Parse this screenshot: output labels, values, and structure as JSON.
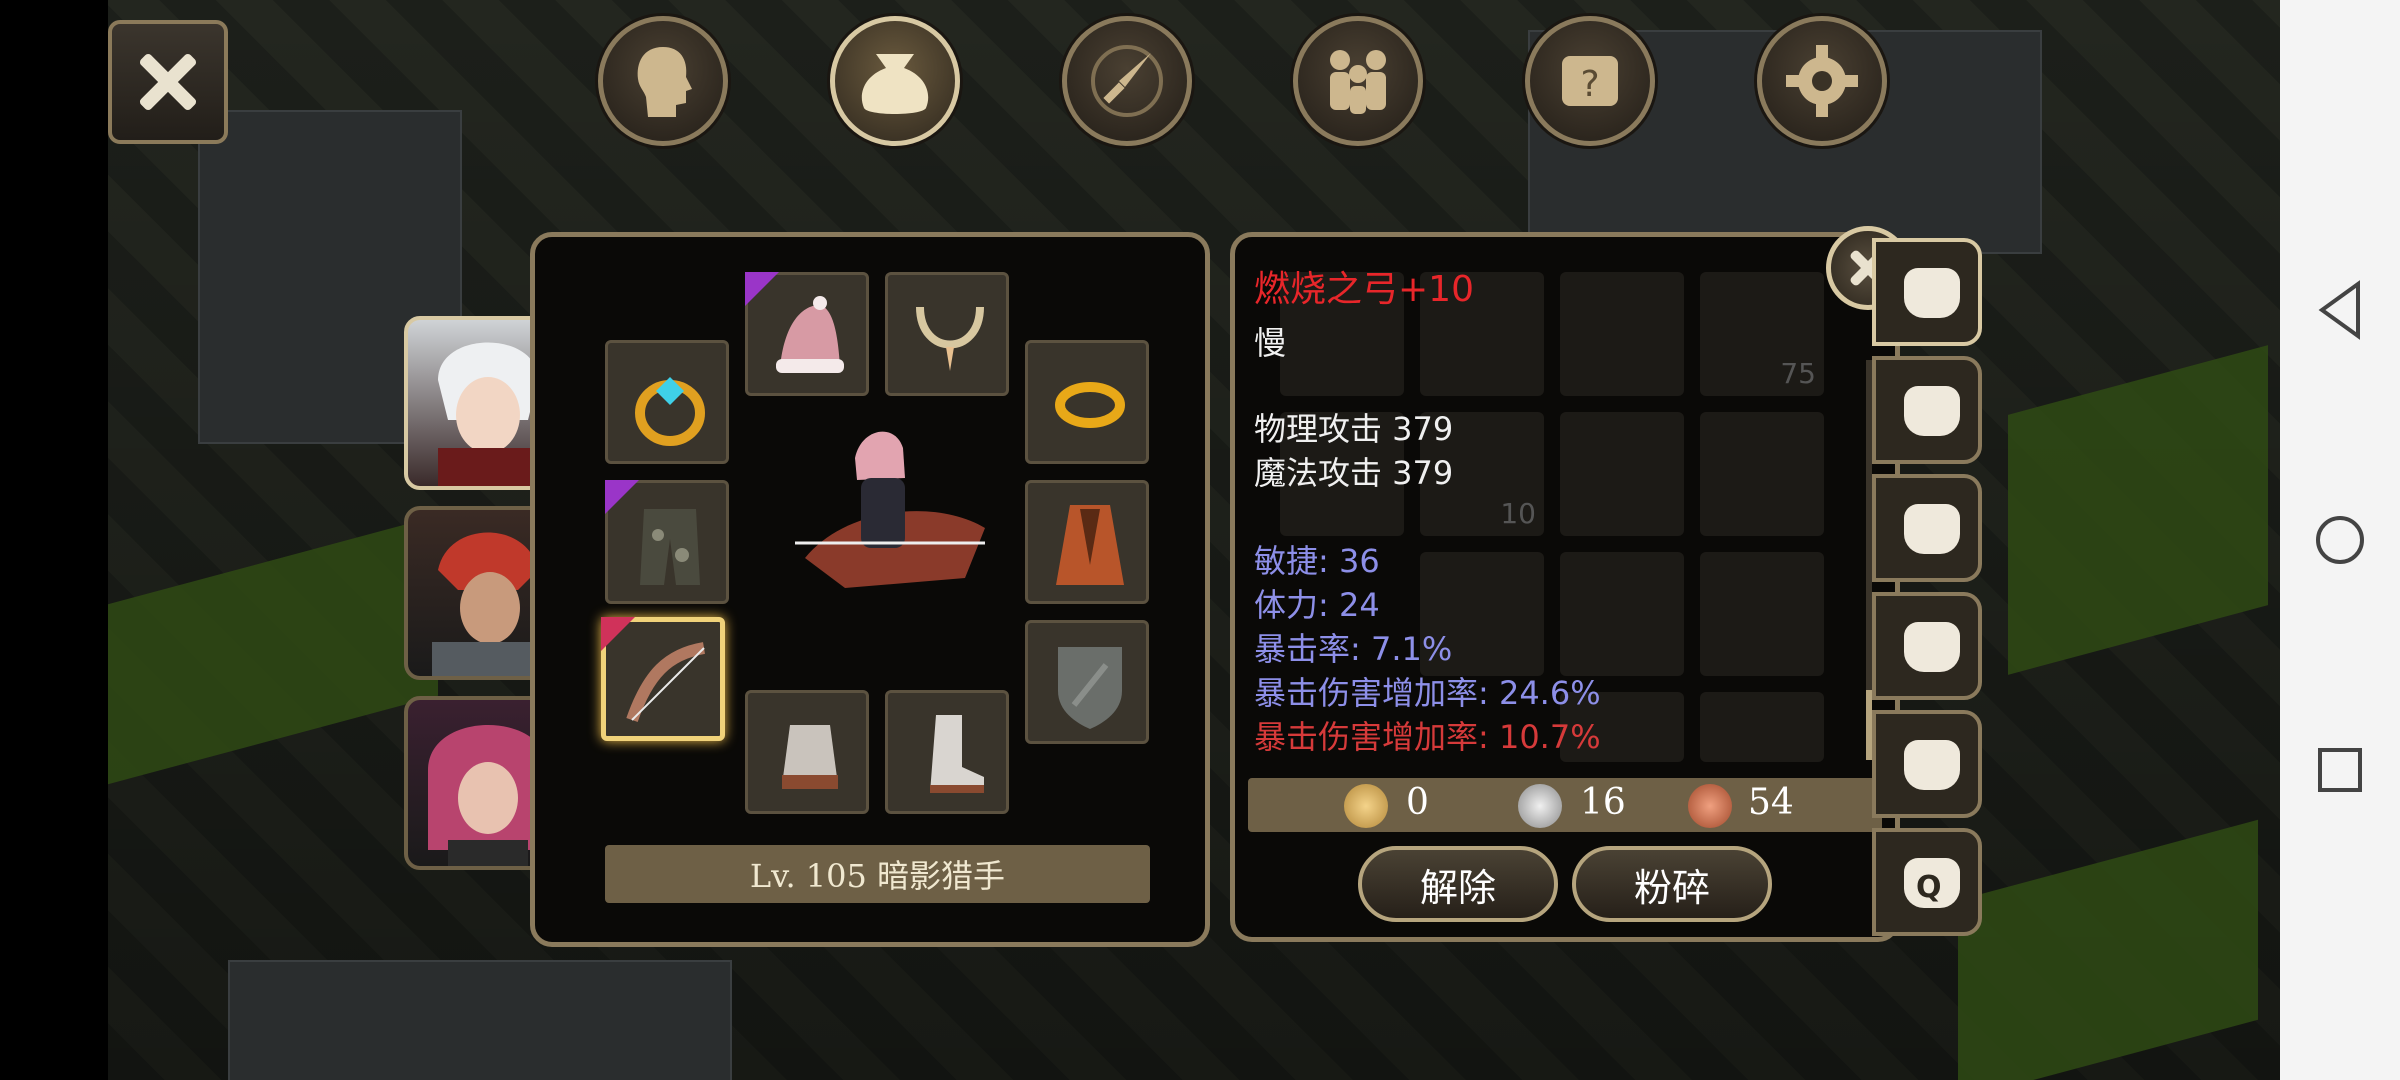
{
  "item": {
    "name": "燃烧之弓+10",
    "speed": "慢",
    "physical_attack": "物理攻击 379",
    "magic_attack": "魔法攻击 379",
    "bonus_stats": [
      "敏捷: 36",
      "体力: 24",
      "暴击率: 7.1%",
      "暴击伤害增加率: 24.6%"
    ],
    "special_stat": "暴击伤害增加率: 10.7%"
  },
  "character": {
    "label": "Lv. 105 暗影猎手"
  },
  "currency": {
    "gold": "0",
    "silver": "16",
    "copper": "54"
  },
  "buttons": {
    "unequip": "解除",
    "smash": "粉碎"
  },
  "background_counts": {
    "a": "75",
    "b": "10"
  },
  "tab_quest_letter": "Q",
  "colors": {
    "item_name": "#e8262a",
    "bonus_stat": "#8d8fe8",
    "special_stat": "#d63a3a",
    "frame": "#8a7a5c",
    "selected_slot": "#f0d27a"
  }
}
